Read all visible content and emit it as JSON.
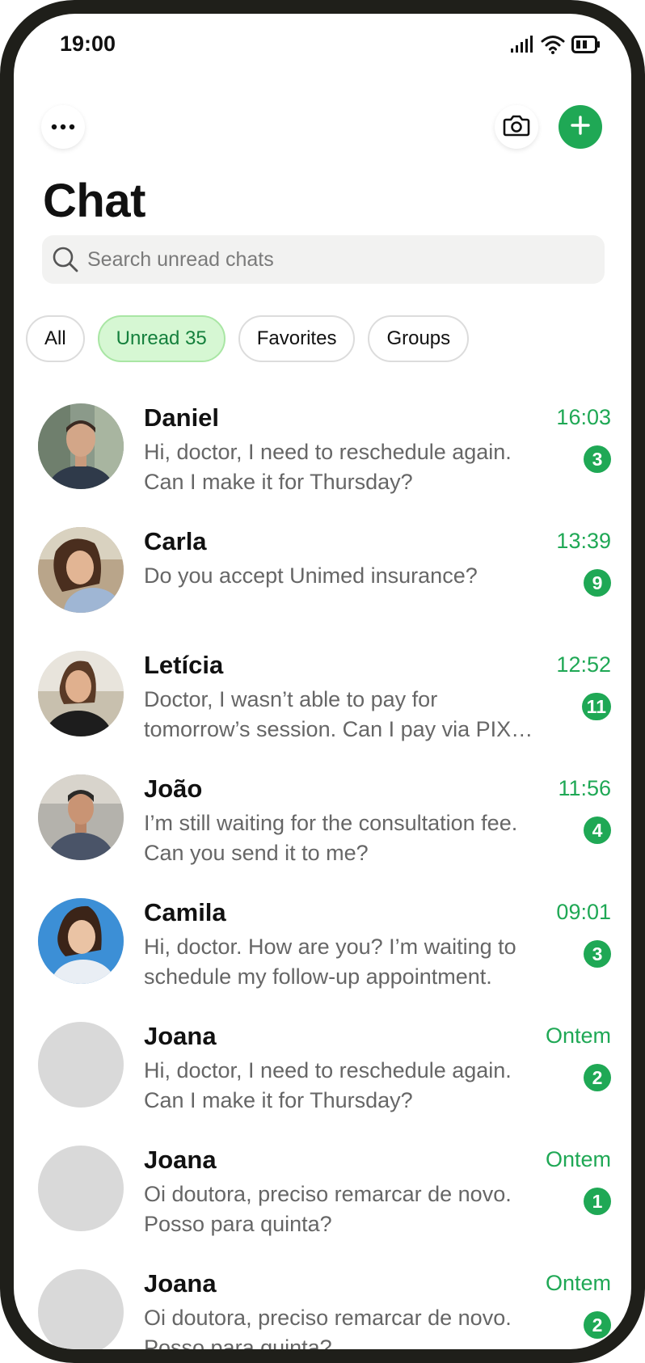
{
  "status_bar": {
    "time": "19:00"
  },
  "header": {
    "title": "Chat"
  },
  "search": {
    "placeholder": "Search unread chats"
  },
  "filters": [
    "All",
    "Unread 35",
    "Favorites",
    "Groups"
  ],
  "active_filter": "Unread 35",
  "colors": {
    "accent": "#1fa855",
    "chip_active_bg": "#d6f7d3",
    "frame": "#1f1f1a"
  },
  "chats": [
    {
      "name": "Daniel",
      "preview": "Hi, doctor, I need to reschedule again. Can I make it for Thursday?",
      "time": "16:03",
      "unread": "3",
      "avatar": "photo"
    },
    {
      "name": "Carla",
      "preview": "Do you accept Unimed insurance?",
      "time": "13:39",
      "unread": "9",
      "avatar": "photo"
    },
    {
      "name": "Letícia",
      "preview": "Doctor, I wasn’t able to pay for tomorrow’s session. Can I pay via PIX later today?",
      "time": "12:52",
      "unread": "11",
      "avatar": "photo"
    },
    {
      "name": "João",
      "preview": "I’m still waiting for the consultation fee. Can you send it to me?",
      "time": "11:56",
      "unread": "4",
      "avatar": "photo"
    },
    {
      "name": "Camila",
      "preview": "Hi, doctor. How are you? I’m waiting to schedule my follow-up appointment.",
      "time": "09:01",
      "unread": "3",
      "avatar": "photo"
    },
    {
      "name": "Joana",
      "preview": "Hi, doctor, I need to reschedule again. Can I make it for Thursday?",
      "time": "Ontem",
      "unread": "2",
      "avatar": "placeholder"
    },
    {
      "name": "Joana",
      "preview": "Oi doutora, preciso remarcar de novo. Posso para quinta?",
      "time": "Ontem",
      "unread": "1",
      "avatar": "placeholder"
    },
    {
      "name": "Joana",
      "preview": "Oi doutora, preciso remarcar de novo. Posso para quinta?",
      "time": "Ontem",
      "unread": "2",
      "avatar": "placeholder"
    }
  ]
}
